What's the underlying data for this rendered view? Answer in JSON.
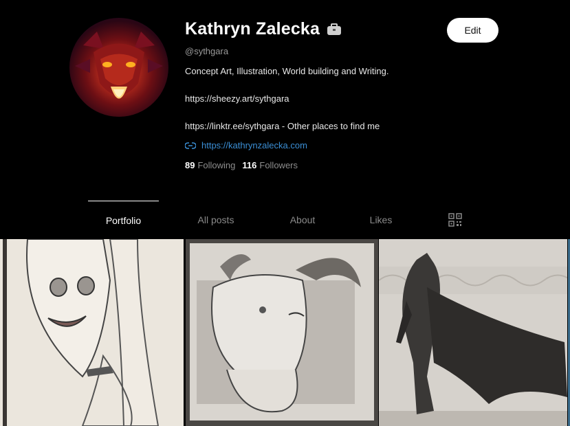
{
  "profile": {
    "name": "Kathryn Zalecka",
    "handle": "@sythgara",
    "bio": [
      "Concept Art, Illustration, World building and Writing.",
      "https://sheezy.art/sythgara",
      "https://linktr.ee/sythgara - Other places to find me"
    ],
    "website": "https://kathrynzalecka.com",
    "following_count": "89",
    "following_label": "Following",
    "followers_count": "116",
    "followers_label": "Followers",
    "badge_icon": "briefcase-icon",
    "avatar_icon": "dragon-avatar"
  },
  "actions": {
    "edit_label": "Edit"
  },
  "tabs": [
    {
      "label": "Portfolio",
      "active": true
    },
    {
      "label": "All posts",
      "active": false
    },
    {
      "label": "About",
      "active": false
    },
    {
      "label": "Likes",
      "active": false
    },
    {
      "icon": "qr-code-icon",
      "active": false
    }
  ],
  "colors": {
    "background": "#000000",
    "link": "#3b8fd6",
    "muted": "#8a8a8a",
    "button_bg": "#ffffff"
  }
}
